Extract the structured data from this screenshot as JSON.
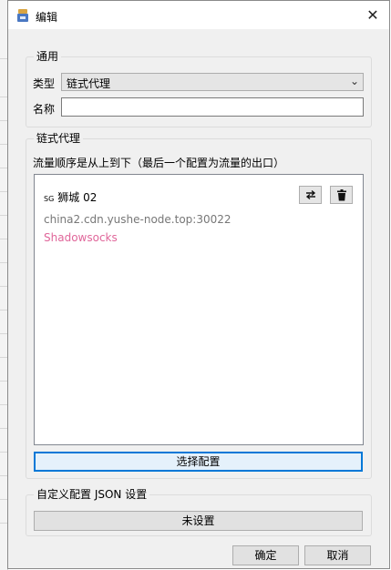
{
  "window": {
    "title": "编辑",
    "close_glyph": "✕"
  },
  "general": {
    "title": "通用",
    "type_label": "类型",
    "type_value": "链式代理",
    "name_label": "名称",
    "name_value": ""
  },
  "chain": {
    "title": "链式代理",
    "hint": "流量顺序是从上到下（最后一个配置为流量的出口）",
    "items": [
      {
        "flag": "SG",
        "name": "狮城 02",
        "address": "china2.cdn.yushe-node.top:30022",
        "protocol": "Shadowsocks"
      }
    ],
    "select_button": "选择配置"
  },
  "custom": {
    "title": "自定义配置 JSON 设置",
    "button": "未设置"
  },
  "footer": {
    "ok": "确定",
    "cancel": "取消"
  },
  "colors": {
    "accent": "#0078d7",
    "protocol": "#e0669a"
  }
}
